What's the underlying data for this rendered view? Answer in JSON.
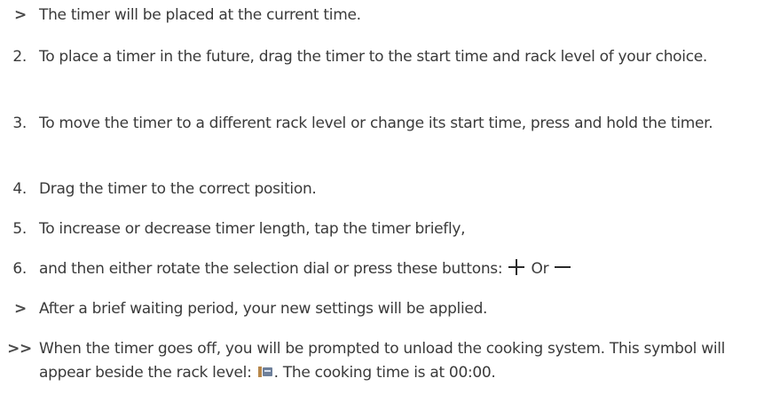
{
  "steps": [
    {
      "marker": ">",
      "text": "The timer will be placed at the current time."
    },
    {
      "marker": "2.",
      "text": "To place a timer in the future, drag the timer to the start time and rack level of your choice."
    },
    {
      "marker": "3.",
      "text": "To move the timer to a different rack level or change its start time, press and hold the timer."
    },
    {
      "marker": "4.",
      "text": "Drag the timer to the correct position."
    },
    {
      "marker": "5.",
      "text": "To increase or decrease timer length, tap the timer briefly,"
    },
    {
      "marker": "6.",
      "text_before": "and then either rotate the selection dial or press these buttons:",
      "or_text": "Or"
    },
    {
      "marker": ">",
      "text": "After a brief waiting period, your new settings will be applied."
    },
    {
      "marker": ">>",
      "text_before": "When the timer goes off, you will be prompted to unload the cooking system. This symbol will appear beside the rack level:",
      "text_after": ". The cooking time is at 00:00."
    }
  ],
  "icons": {
    "plus": "plus-icon",
    "minus": "minus-icon",
    "unload": "unload-rack-icon"
  }
}
